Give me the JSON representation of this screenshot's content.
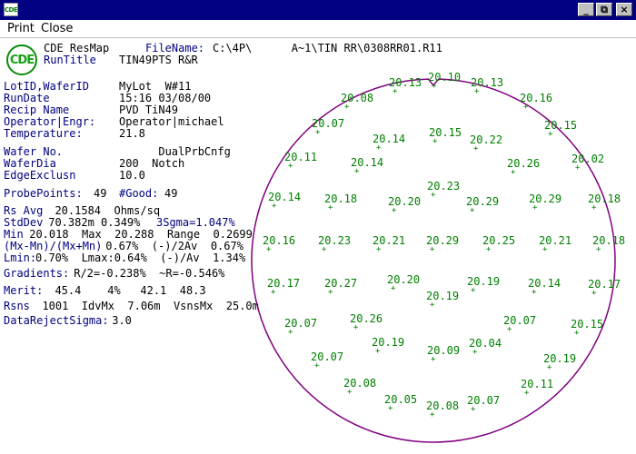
{
  "window": {
    "app_icon_text": "CDE",
    "buttons": [
      "_",
      "⧉",
      "×"
    ]
  },
  "menu": [
    "Print",
    "Close"
  ],
  "header": {
    "logo_text": "CDE",
    "product": "CDE ResMap",
    "filename_label": "FileName:",
    "filename_value": "C:\\4P\\      A~1\\TIN RR\\0308RR01.R11",
    "runtitle_label": "RunTitle",
    "runtitle_value": "TIN49PTS R&R"
  },
  "fields": [
    {
      "label": "LotID,WaferID",
      "value": "MyLot  W#11"
    },
    {
      "label": "RunDate",
      "value": "15:16 03/08/00"
    },
    {
      "label": "Recip Name",
      "value": "PVD TiN49"
    },
    {
      "label": "Operator|Engr:",
      "value": "Operator|michael"
    },
    {
      "label": "Temperature:",
      "value": "21.8"
    },
    {
      "label": "Wafer No.",
      "value": "      DualPrbCnfg"
    },
    {
      "label": "WaferDia",
      "value": "200  Notch"
    },
    {
      "label": "EdgeExclusn",
      "value": "10.0"
    }
  ],
  "probe": {
    "label": "ProbePoints:",
    "value": "49",
    "good_label": "#Good:",
    "good_value": "49"
  },
  "stats": [
    {
      "label": "Rs Avg",
      "value": "  20.1584  Ohms/sq"
    },
    {
      "label": "StdDev",
      "value": " 70.382m 0.349%",
      "label2": "3Sgma=1.047%"
    },
    {
      "label": "Min",
      "value": " 20.018  Max  20.288  Range  0.2699"
    },
    {
      "label": "(Mx-Mn)/(Mx+Mn)",
      "value": " 0.67%  (-)/2Av  0.67%"
    },
    {
      "label": "Lmin:",
      "value": "0.70%  Lmax:0.64%  (-)/Av  1.34%"
    },
    {
      "label": "Gradients:",
      "value": " R/2=-0.238%  ~R=-0.546%"
    },
    {
      "label": "Merit:",
      "value": "  45.4    4%   42.1  48.3"
    },
    {
      "label": "Rsns",
      "value": "  1001  IdvMx  7.06m  VsnsMx  25.0m"
    },
    {
      "label": "DataRejectSigma:",
      "value": " 3.0"
    }
  ],
  "wafer_map": {
    "outline_color": "#800080",
    "value_color": "#008000",
    "sites": [
      {
        "v": "20.10"
      },
      {
        "v": "20.13"
      },
      {
        "v": "20.13"
      },
      {
        "v": "20.08"
      },
      {
        "v": "20.16"
      },
      {
        "v": "20.07"
      },
      {
        "v": "20.15"
      },
      {
        "v": "20.14"
      },
      {
        "v": "20.15"
      },
      {
        "v": "20.22"
      },
      {
        "v": "20.11"
      },
      {
        "v": "20.14"
      },
      {
        "v": "20.26"
      },
      {
        "v": "20.02"
      },
      {
        "v": "20.23"
      },
      {
        "v": "20.14"
      },
      {
        "v": "20.18"
      },
      {
        "v": "20.20"
      },
      {
        "v": "20.29"
      },
      {
        "v": "20.29"
      },
      {
        "v": "20.18"
      },
      {
        "v": "20.16"
      },
      {
        "v": "20.23"
      },
      {
        "v": "20.21"
      },
      {
        "v": "20.29"
      },
      {
        "v": "20.25"
      },
      {
        "v": "20.21"
      },
      {
        "v": "20.18"
      },
      {
        "v": "20.17"
      },
      {
        "v": "20.27"
      },
      {
        "v": "20.20"
      },
      {
        "v": "20.19"
      },
      {
        "v": "20.19"
      },
      {
        "v": "20.14"
      },
      {
        "v": "20.17"
      },
      {
        "v": "20.26"
      },
      {
        "v": "20.07"
      },
      {
        "v": "20.07"
      },
      {
        "v": "20.15"
      },
      {
        "v": "20.19"
      },
      {
        "v": "20.09"
      },
      {
        "v": "20.04"
      },
      {
        "v": "20.07"
      },
      {
        "v": "20.19"
      },
      {
        "v": "20.08"
      },
      {
        "v": "20.11"
      },
      {
        "v": "20.05"
      },
      {
        "v": "20.08"
      },
      {
        "v": "20.07"
      }
    ]
  }
}
